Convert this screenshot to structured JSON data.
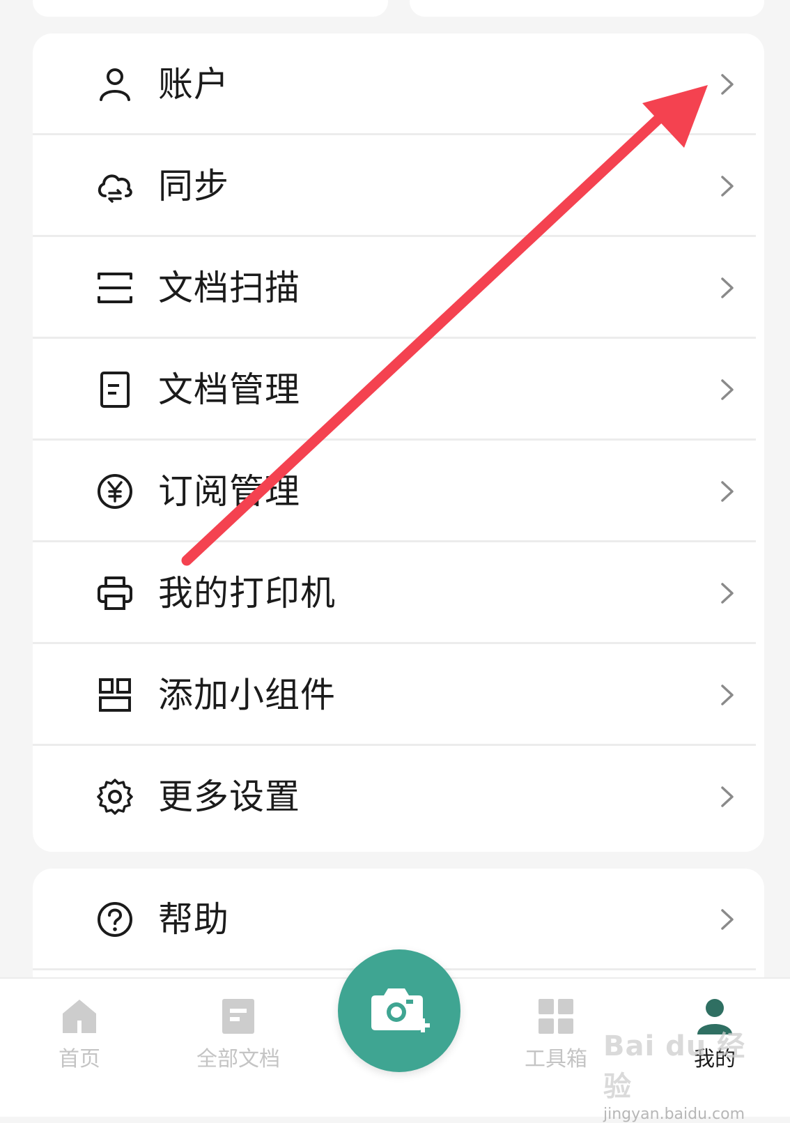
{
  "menu": {
    "items": [
      {
        "label": "账户",
        "icon": "person-icon"
      },
      {
        "label": "同步",
        "icon": "cloud-sync-icon"
      },
      {
        "label": "文档扫描",
        "icon": "scan-icon"
      },
      {
        "label": "文档管理",
        "icon": "document-icon"
      },
      {
        "label": "订阅管理",
        "icon": "yen-icon"
      },
      {
        "label": "我的打印机",
        "icon": "printer-icon"
      },
      {
        "label": "添加小组件",
        "icon": "widget-icon"
      },
      {
        "label": "更多设置",
        "icon": "gear-icon"
      }
    ],
    "help": {
      "label": "帮助",
      "icon": "help-icon"
    }
  },
  "tabbar": {
    "home": "首页",
    "all_docs": "全部文档",
    "toolbox": "工具箱",
    "mine": "我的",
    "camera_icon": "camera-plus-icon"
  },
  "watermark": {
    "main": "Bai du 经验",
    "sub": "jingyan.baidu.com"
  },
  "colors": {
    "accent": "#3fa592",
    "arrow": "#f44250",
    "inactive": "#c4c4c4",
    "active_icon": "#2f6f62"
  }
}
